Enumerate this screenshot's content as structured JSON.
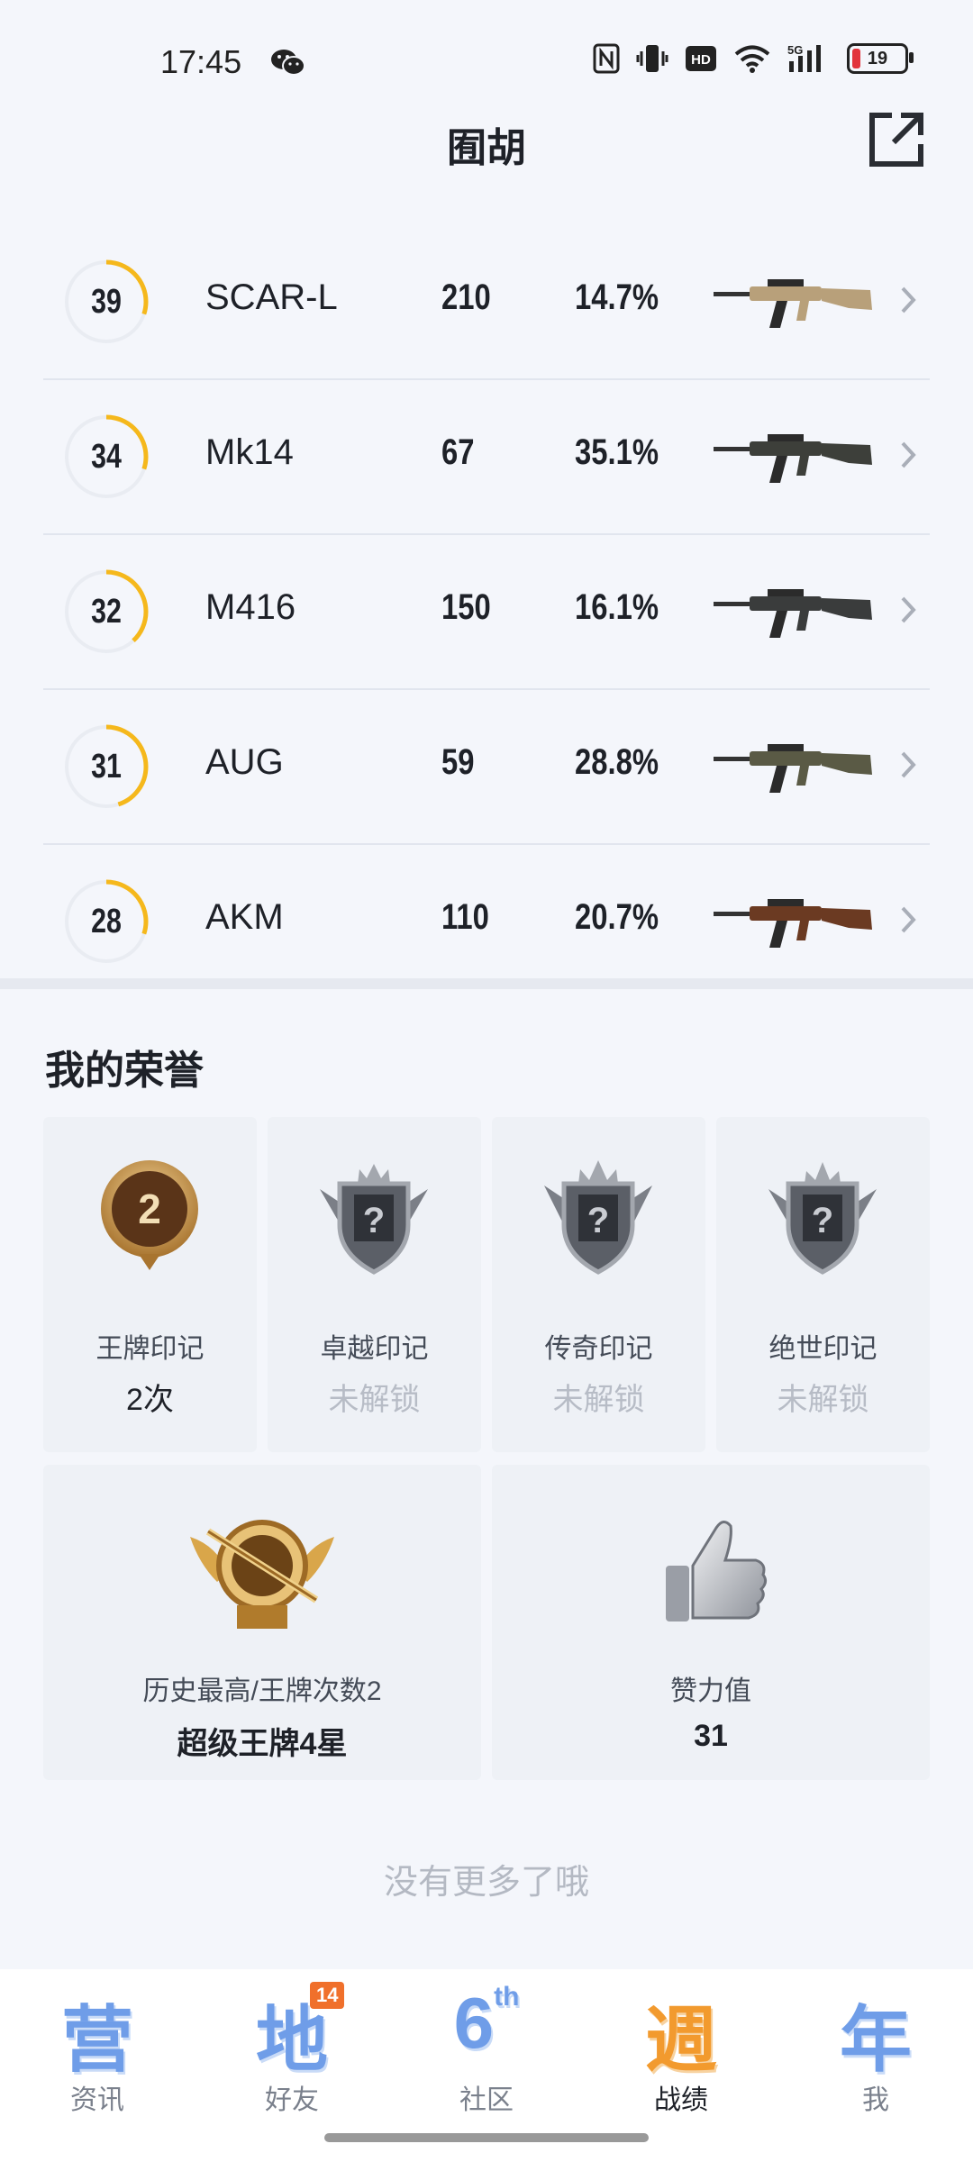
{
  "status_bar": {
    "time": "17:45",
    "battery": "19",
    "icons": [
      "wechat-icon",
      "nfc-icon",
      "vibrate-icon",
      "hd-icon",
      "wifi-icon",
      "signal-5g-icon",
      "battery-icon"
    ]
  },
  "header": {
    "title": "囿胡",
    "share_icon": "share-external-icon"
  },
  "weapons": [
    {
      "level": "39",
      "level_fill": 0.3,
      "name": "SCAR-L",
      "kills": "210",
      "rate": "14.7%",
      "color": "#b8a07a"
    },
    {
      "level": "34",
      "level_fill": 0.3,
      "name": "Mk14",
      "kills": "67",
      "rate": "35.1%",
      "color": "#3d3f3a"
    },
    {
      "level": "32",
      "level_fill": 0.38,
      "name": "M416",
      "kills": "150",
      "rate": "16.1%",
      "color": "#3a3c3c"
    },
    {
      "level": "31",
      "level_fill": 0.45,
      "name": "AUG",
      "kills": "59",
      "rate": "28.8%",
      "color": "#5a5a45"
    },
    {
      "level": "28",
      "level_fill": 0.3,
      "name": "AKM",
      "kills": "110",
      "rate": "20.7%",
      "color": "#6b3a22"
    }
  ],
  "honors": {
    "title": "我的荣誉",
    "badges": [
      {
        "name": "王牌印记",
        "value": "2次",
        "locked": false
      },
      {
        "name": "卓越印记",
        "value": "未解锁",
        "locked": true
      },
      {
        "name": "传奇印记",
        "value": "未解锁",
        "locked": true
      },
      {
        "name": "绝世印记",
        "value": "未解锁",
        "locked": true
      }
    ],
    "badge_number": "2",
    "stats": [
      {
        "label": "历史最高/王牌次数2",
        "value": "超级王牌4星",
        "icon": "super-ace-emblem-icon"
      },
      {
        "label": "赞力值",
        "value": "31",
        "icon": "thumbs-up-icon"
      }
    ]
  },
  "footer": {
    "no_more": "没有更多了哦"
  },
  "nav": {
    "items": [
      {
        "glyph": "营",
        "sup": "",
        "label": "资讯",
        "active": false
      },
      {
        "glyph": "地",
        "sup": "",
        "label": "好友",
        "active": false,
        "badge": "14"
      },
      {
        "glyph": "6",
        "sup": "th",
        "label": "社区",
        "active": false
      },
      {
        "glyph": "週",
        "sup": "",
        "label": "战绩",
        "active": true
      },
      {
        "glyph": "年",
        "sup": "",
        "label": "我",
        "active": false
      }
    ]
  },
  "colors": {
    "ring_accent": "#f5b81c",
    "ring_track": "#e9ecf2",
    "nav_active": "#f29a2e",
    "nav_inactive": "#6f9de8"
  }
}
